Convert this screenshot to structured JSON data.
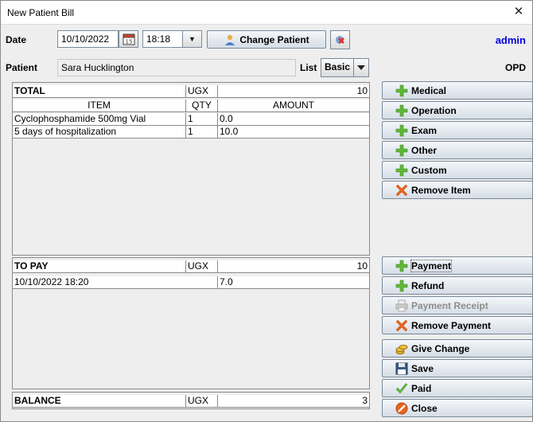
{
  "window": {
    "title": "New Patient Bill"
  },
  "header": {
    "date_label": "Date",
    "date_value": "10/10/2022",
    "time_value": "18:18",
    "change_patient_label": "Change Patient",
    "user": "admin"
  },
  "patient": {
    "label": "Patient",
    "name": "Sara Hucklington",
    "list_label": "List",
    "list_value": "Basic",
    "ward": "OPD"
  },
  "items": {
    "total_label": "TOTAL",
    "currency": "UGX",
    "total_value": "10",
    "columns": [
      "ITEM",
      "QTY",
      "AMOUNT"
    ],
    "rows": [
      {
        "item": "Cyclophosphamide 500mg Vial",
        "qty": "1",
        "amount": "0.0"
      },
      {
        "item": "5 days of hospitalization",
        "qty": "1",
        "amount": "10.0"
      }
    ]
  },
  "payments": {
    "label": "TO PAY",
    "currency": "UGX",
    "value": "10",
    "rows": [
      {
        "date": "10/10/2022 18:20",
        "amount": "7.0"
      }
    ]
  },
  "balance": {
    "label": "BALANCE",
    "currency": "UGX",
    "value": "3"
  },
  "buttons": {
    "medical": "Medical",
    "operation": "Operation",
    "exam": "Exam",
    "other": "Other",
    "custom": "Custom",
    "remove_item": "Remove Item",
    "payment": "Payment",
    "refund": "Refund",
    "payment_receipt": "Payment Receipt",
    "remove_payment": "Remove Payment",
    "give_change": "Give Change",
    "save": "Save",
    "paid": "Paid",
    "close": "Close"
  },
  "colors": {
    "user": "#0000dd",
    "plus": "#5fb83a",
    "remove": "#e8641c"
  }
}
